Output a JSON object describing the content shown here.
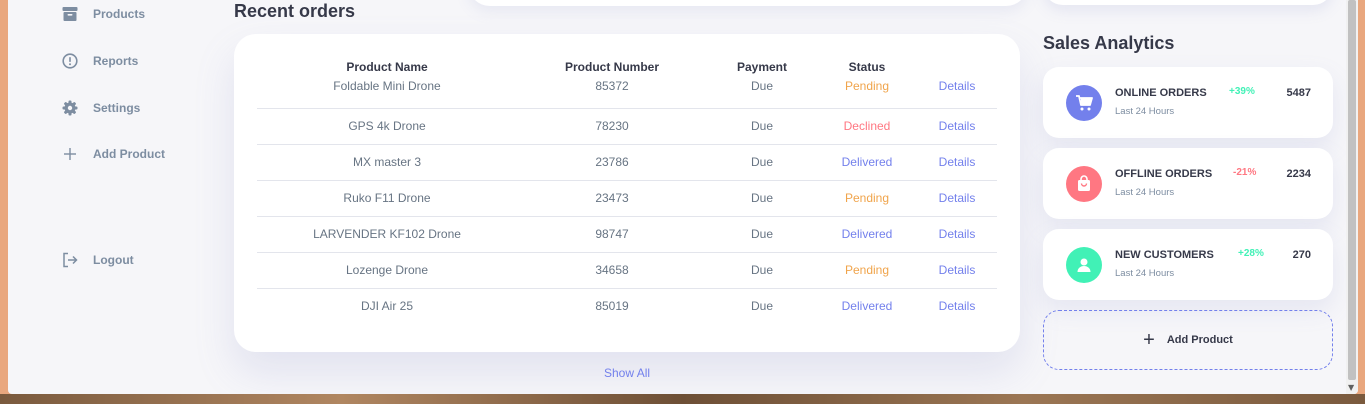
{
  "sidebar": {
    "items": [
      {
        "label": "Products",
        "icon": "archive-icon"
      },
      {
        "label": "Reports",
        "icon": "report-icon"
      },
      {
        "label": "Settings",
        "icon": "gear-icon"
      },
      {
        "label": "Add Product",
        "icon": "plus-icon"
      },
      {
        "label": "Logout",
        "icon": "logout-icon"
      }
    ]
  },
  "orders": {
    "title": "Recent orders",
    "columns": [
      "Product Name",
      "Product Number",
      "Payment",
      "Status",
      ""
    ],
    "rows": [
      {
        "name": "Foldable Mini Drone",
        "number": "85372",
        "payment": "Due",
        "status": "Pending",
        "action": "Details"
      },
      {
        "name": "GPS 4k Drone",
        "number": "78230",
        "payment": "Due",
        "status": "Declined",
        "action": "Details"
      },
      {
        "name": "MX master 3",
        "number": "23786",
        "payment": "Due",
        "status": "Delivered",
        "action": "Details"
      },
      {
        "name": "Ruko F11 Drone",
        "number": "23473",
        "payment": "Due",
        "status": "Pending",
        "action": "Details"
      },
      {
        "name": "LARVENDER KF102 Drone",
        "number": "98747",
        "payment": "Due",
        "status": "Delivered",
        "action": "Details"
      },
      {
        "name": "Lozenge Drone",
        "number": "34658",
        "payment": "Due",
        "status": "Pending",
        "action": "Details"
      },
      {
        "name": "DJI Air 25",
        "number": "85019",
        "payment": "Due",
        "status": "Delivered",
        "action": "Details"
      }
    ],
    "show_all": "Show All"
  },
  "analytics": {
    "title": "Sales Analytics",
    "cards": [
      {
        "title": "ONLINE ORDERS",
        "sub": "Last 24 Hours",
        "pct": "+39%",
        "value": "5487",
        "icon": "cart-icon",
        "color": "#7380ec",
        "pct_color": "#41f1b6"
      },
      {
        "title": "OFFLINE ORDERS",
        "sub": "Last 24 Hours",
        "pct": "-21%",
        "value": "2234",
        "icon": "shopping-bag-icon",
        "color": "#ff7782",
        "pct_color": "#ff7782"
      },
      {
        "title": "NEW CUSTOMERS",
        "sub": "Last 24 Hours",
        "pct": "+28%",
        "value": "270",
        "icon": "person-icon",
        "color": "#41f1b6",
        "pct_color": "#41f1b6"
      }
    ],
    "add_product": {
      "label": "Add Product",
      "icon": "plus-icon"
    }
  },
  "colors": {
    "primary": "#7380ec",
    "danger": "#ff7782",
    "success": "#41f1b6",
    "warning": "#ffbb55"
  }
}
